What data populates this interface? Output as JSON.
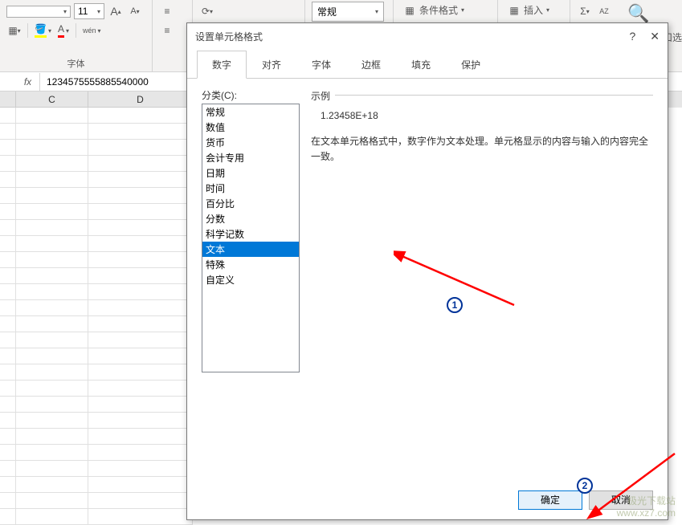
{
  "ribbon": {
    "font_size": "11",
    "increase_font_hint": "A",
    "decrease_font_hint": "A",
    "pinyin_btn": "wén",
    "font_section_label": "字体",
    "num_format_selected": "常规",
    "cond_format": "条件格式",
    "insert": "插入",
    "sort_filter_hint": "AZ",
    "right_clip": "扣选"
  },
  "formula_bar": {
    "fx": "fx",
    "value": "1234575555885540000"
  },
  "grid": {
    "cols": [
      "C",
      "D"
    ]
  },
  "dialog": {
    "title": "设置单元格格式",
    "help": "?",
    "close": "✕",
    "tabs": [
      "数字",
      "对齐",
      "字体",
      "边框",
      "填充",
      "保护"
    ],
    "active_tab": 0,
    "category_label": "分类(C):",
    "categories": [
      "常规",
      "数值",
      "货币",
      "会计专用",
      "日期",
      "时间",
      "百分比",
      "分数",
      "科学记数",
      "文本",
      "特殊",
      "自定义"
    ],
    "selected_index": 9,
    "sample_label": "示例",
    "sample_value": "1.23458E+18",
    "description": "在文本单元格格式中，数字作为文本处理。单元格显示的内容与输入的内容完全一致。",
    "ok": "确定",
    "cancel": "取消"
  },
  "annotations": {
    "n1": "1",
    "n2": "2"
  },
  "watermark": {
    "line1": "极光下载站",
    "line2": "www.xz7.com"
  }
}
